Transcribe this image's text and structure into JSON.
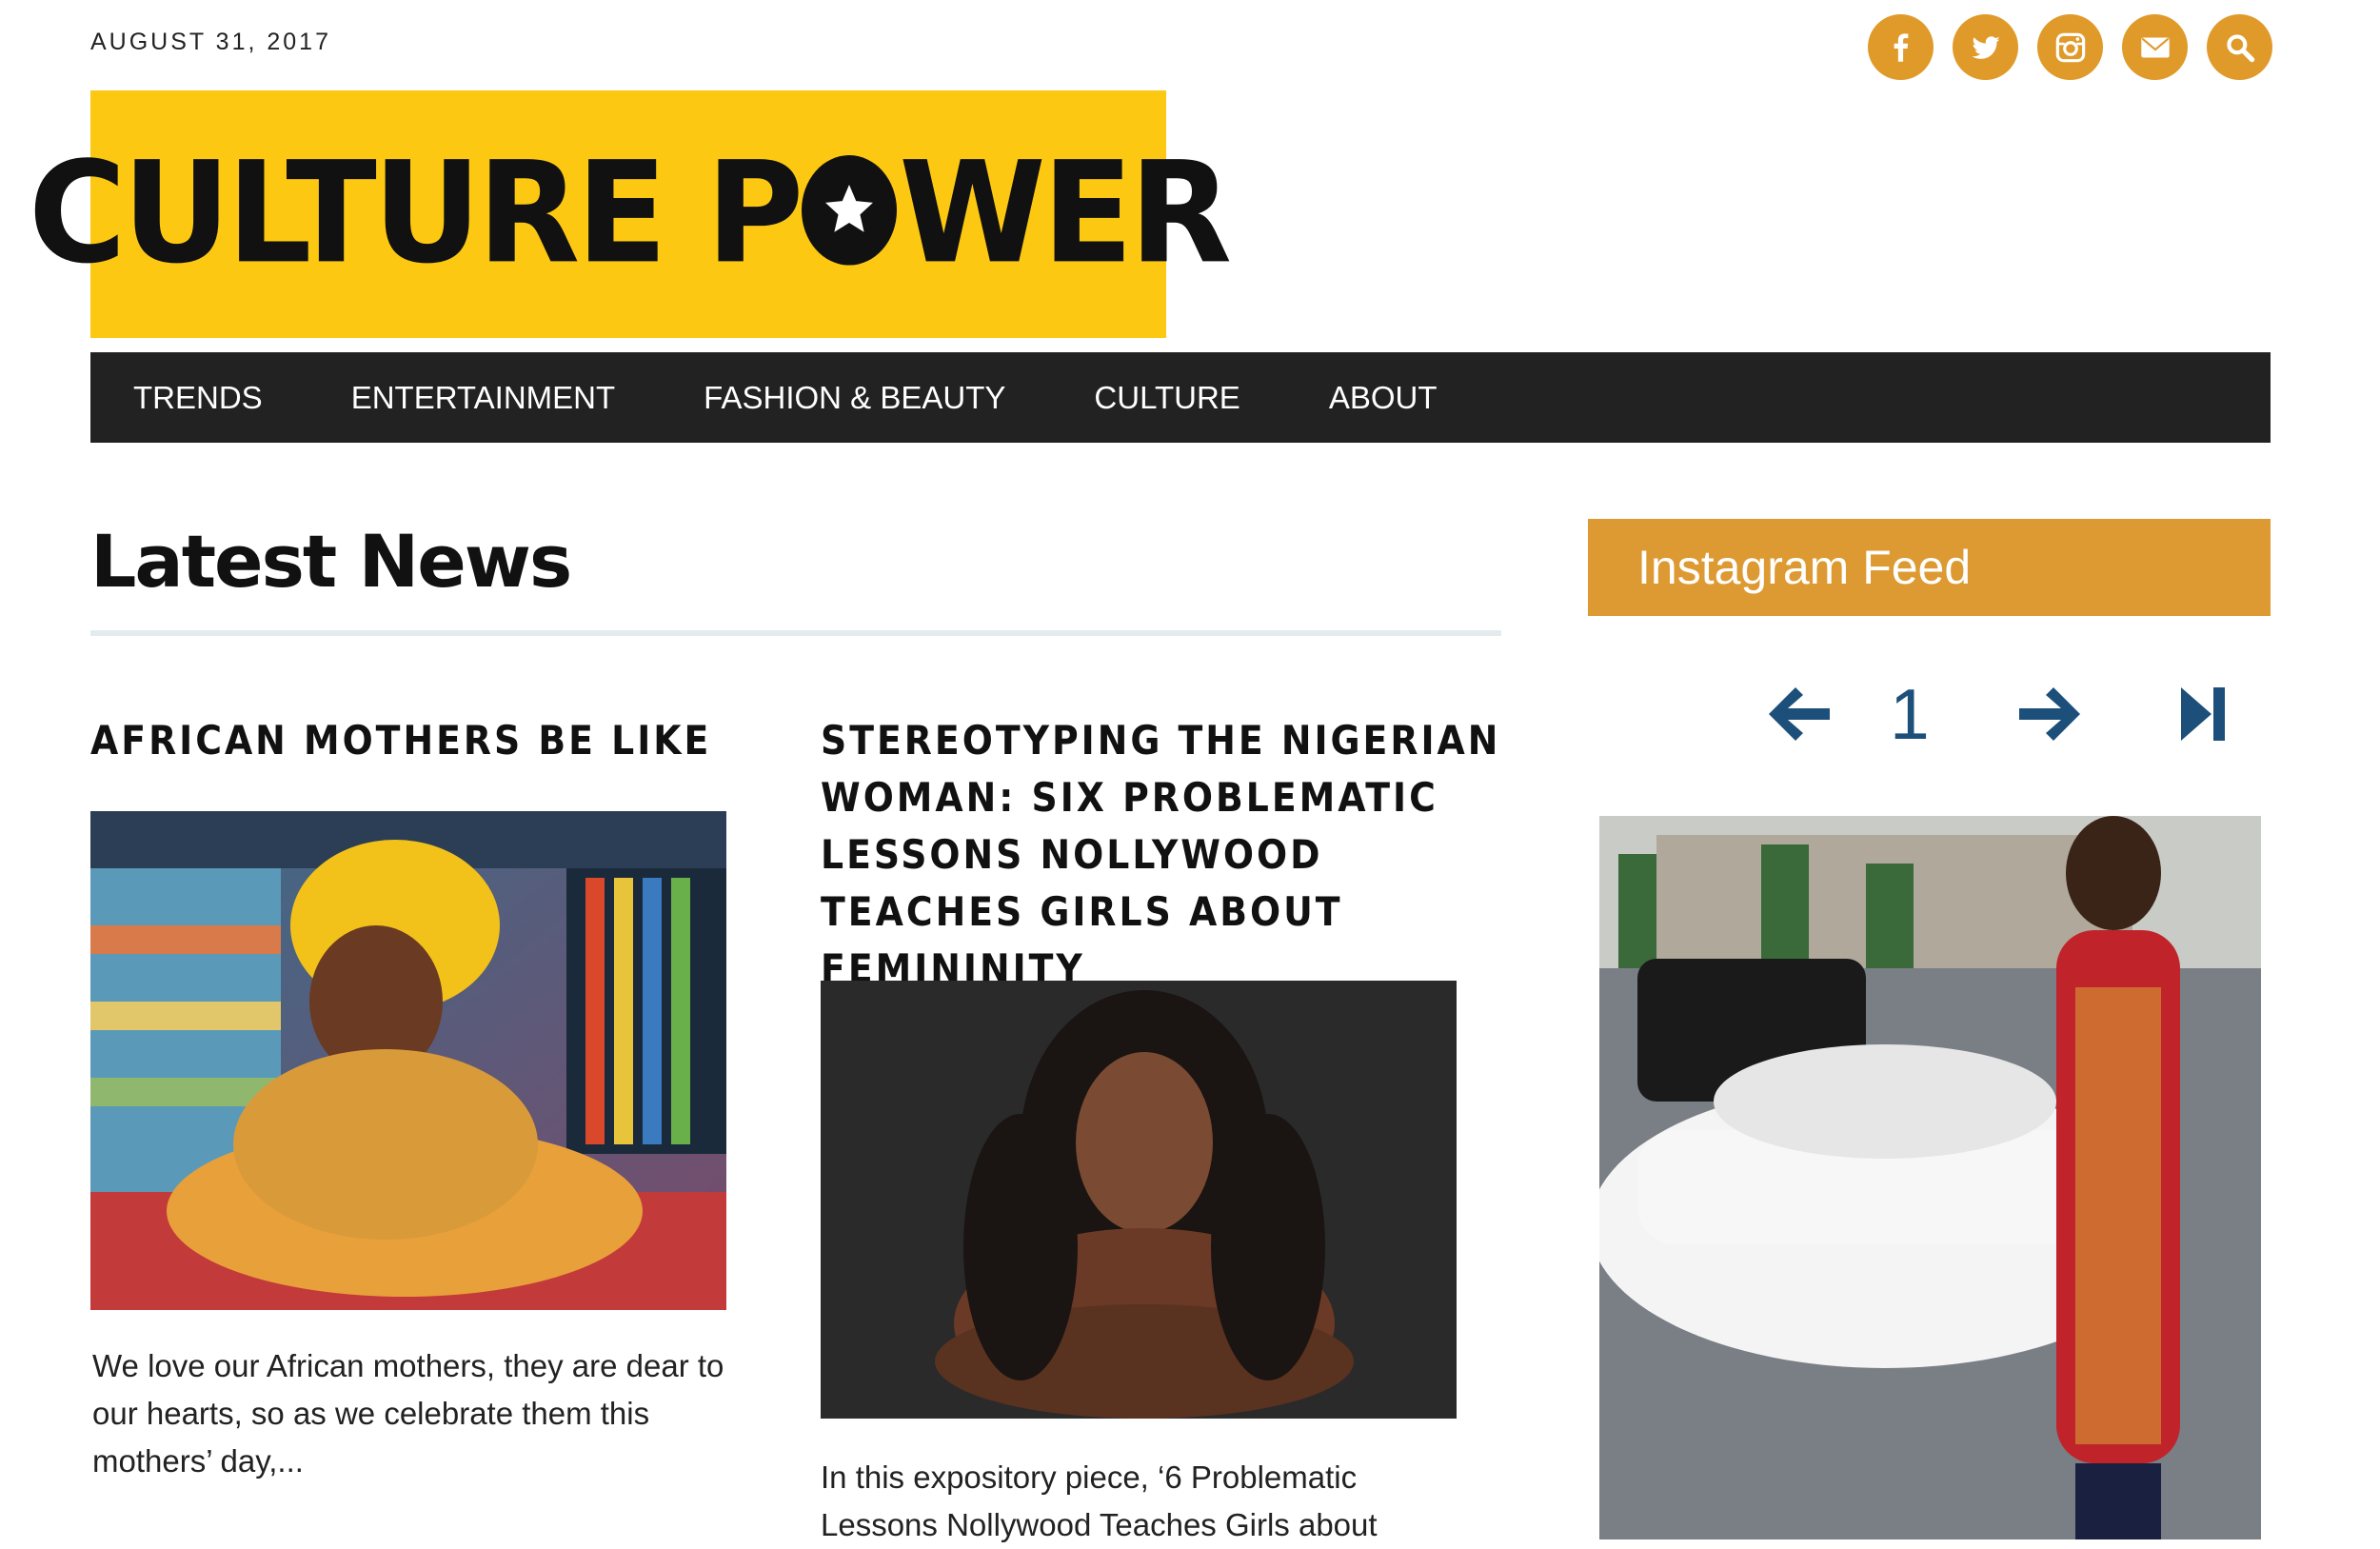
{
  "header": {
    "date": "AUGUST 31, 2017"
  },
  "social": [
    {
      "name": "facebook-icon",
      "glyph": "f"
    },
    {
      "name": "twitter-icon",
      "glyph": "twitter"
    },
    {
      "name": "instagram-icon",
      "glyph": "instagram"
    },
    {
      "name": "email-icon",
      "glyph": "mail"
    },
    {
      "name": "search-icon",
      "glyph": "search"
    }
  ],
  "logo": {
    "left": "CULTURE P",
    "right": "WER"
  },
  "nav": {
    "items": [
      "TRENDS",
      "ENTERTAINMENT",
      "FASHION & BEAUTY",
      "CULTURE",
      "ABOUT"
    ]
  },
  "main": {
    "heading": "Latest News",
    "posts": [
      {
        "title": "AFRICAN MOTHERS BE LIKE",
        "excerpt": "We love our African mothers, they are dear to our hearts, so as we celebrate them this mothers’ day,..."
      },
      {
        "title": "STEREOTYPING THE NIGERIAN WOMAN: SIX PROBLEMATIC LESSONS NOLLYWOOD TEACHES GIRLS ABOUT FEMININITY",
        "excerpt": "In this expository piece, ‘6 Problematic Lessons Nollywood Teaches Girls about"
      }
    ]
  },
  "sidebar": {
    "title": "Instagram Feed",
    "page": "1"
  },
  "colors": {
    "accent": "#dd9a32",
    "brand": "#fcc812",
    "nav": "#222222",
    "pager": "#1c4f7a"
  }
}
